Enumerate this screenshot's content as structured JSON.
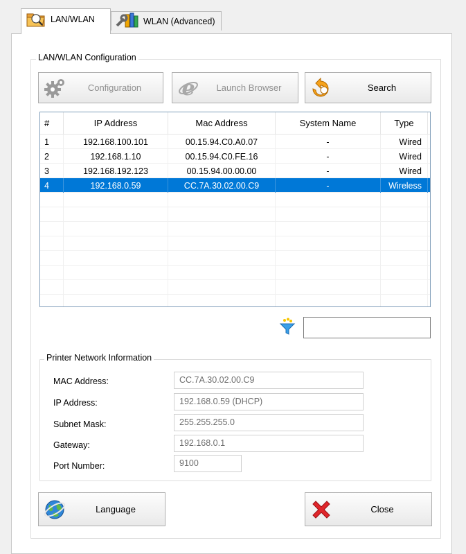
{
  "tabs": [
    {
      "label": "LAN/WLAN",
      "active": true,
      "icon": "folder-lan-icon"
    },
    {
      "label": "WLAN (Advanced)",
      "active": false,
      "icon": "tools-icon"
    }
  ],
  "config_group": {
    "title": "LAN/WLAN Configuration"
  },
  "toolbar": {
    "configuration_label": "Configuration",
    "launch_browser_label": "Launch Browser",
    "search_label": "Search"
  },
  "device_list": {
    "columns": [
      "#",
      "IP Address",
      "Mac Address",
      "System Name",
      "Type"
    ],
    "rows": [
      {
        "num": "1",
        "ip": "192.168.100.101",
        "mac": "00.15.94.C0.A0.07",
        "name": "-",
        "type": "Wired"
      },
      {
        "num": "2",
        "ip": "192.168.1.10",
        "mac": "00.15.94.C0.FE.16",
        "name": "-",
        "type": "Wired"
      },
      {
        "num": "3",
        "ip": "192.168.192.123",
        "mac": "00.15.94.00.00.00",
        "name": "-",
        "type": "Wired"
      },
      {
        "num": "4",
        "ip": "192.168.0.59",
        "mac": "CC.7A.30.02.00.C9",
        "name": "-",
        "type": "Wireless"
      }
    ],
    "selected_index": 3
  },
  "filter": {
    "value": "",
    "icon": "filter-icon"
  },
  "printer_info": {
    "title": "Printer Network Information",
    "mac_label": "MAC Address:",
    "mac_value": "CC.7A.30.02.00.C9",
    "ip_label": "IP Address:",
    "ip_value": "192.168.0.59 (DHCP)",
    "subnet_label": "Subnet Mask:",
    "subnet_value": "255.255.255.0",
    "gateway_label": "Gateway:",
    "gateway_value": "192.168.0.1",
    "port_label": "Port Number:",
    "port_value": "9100"
  },
  "footer": {
    "language_label": "Language",
    "close_label": "Close"
  },
  "colors": {
    "selection": "#0078d7",
    "close_x": "#e0262b"
  }
}
